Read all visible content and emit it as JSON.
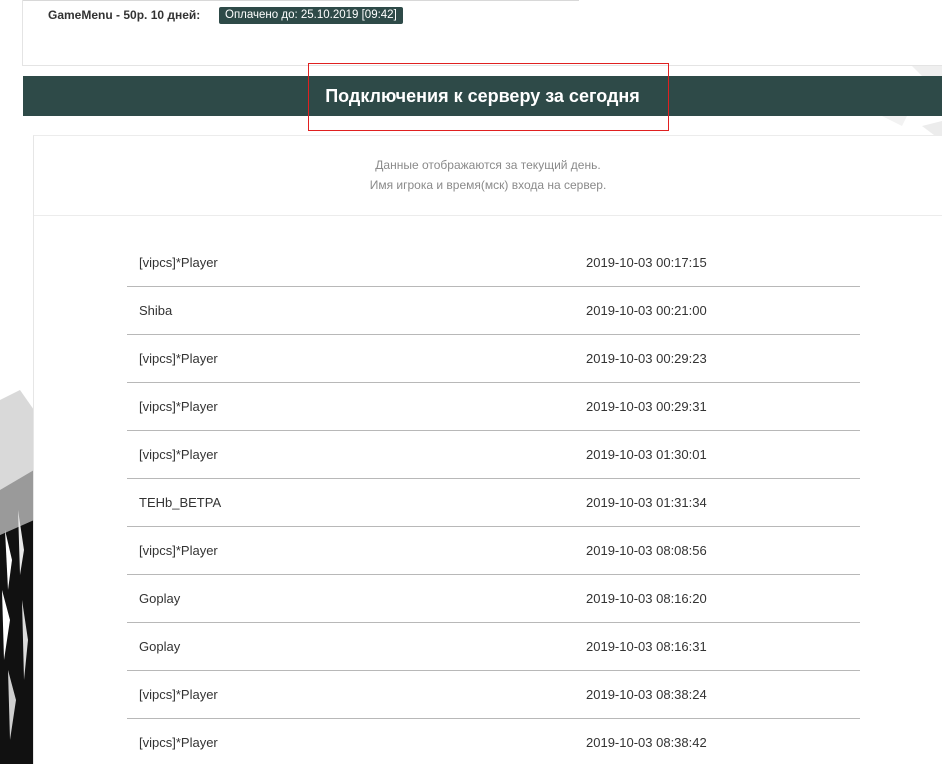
{
  "subscription": {
    "name": "GameMenu - 50р. 10 дней:",
    "paid_until": "Оплачено до: 25.10.2019 [09:42]"
  },
  "section": {
    "title": "Подключения к серверу за сегодня"
  },
  "info": {
    "line1": "Данные отображаются за текущий день.",
    "line2": "Имя игрока и время(мск) входа на сервер."
  },
  "connections": [
    {
      "player": "[vipcs]*Player",
      "time": "2019-10-03 00:17:15"
    },
    {
      "player": "Shiba",
      "time": "2019-10-03 00:21:00"
    },
    {
      "player": "[vipcs]*Player",
      "time": "2019-10-03 00:29:23"
    },
    {
      "player": "[vipcs]*Player",
      "time": "2019-10-03 00:29:31"
    },
    {
      "player": "[vipcs]*Player",
      "time": "2019-10-03 01:30:01"
    },
    {
      "player": "ТЕНb_ВЕТРА",
      "time": "2019-10-03 01:31:34"
    },
    {
      "player": "[vipcs]*Player",
      "time": "2019-10-03 08:08:56"
    },
    {
      "player": "Goplay",
      "time": "2019-10-03 08:16:20"
    },
    {
      "player": "Goplay",
      "time": "2019-10-03 08:16:31"
    },
    {
      "player": "[vipcs]*Player",
      "time": "2019-10-03 08:38:24"
    },
    {
      "player": "[vipcs]*Player",
      "time": "2019-10-03 08:38:42"
    }
  ],
  "colors": {
    "header_bg": "#2e4a48",
    "highlight": "#e02020"
  }
}
